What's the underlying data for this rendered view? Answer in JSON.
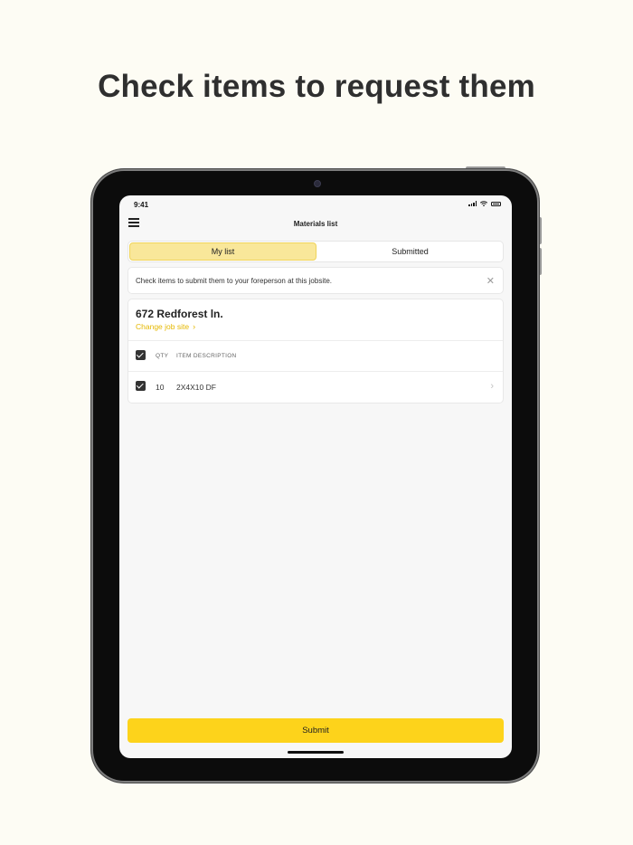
{
  "headline": "Check items to request them",
  "status_bar": {
    "time": "9:41"
  },
  "nav": {
    "title": "Materials list"
  },
  "tabs": [
    {
      "label": "My list",
      "active": true
    },
    {
      "label": "Submitted",
      "active": false
    }
  ],
  "notice": {
    "text": "Check items to submit them to your foreperson at this jobsite."
  },
  "jobsite": {
    "address": "672 Redforest ln.",
    "change_label": "Change job site"
  },
  "table": {
    "headers": {
      "qty": "QTY",
      "description": "ITEM DESCRIPTION"
    },
    "rows": [
      {
        "qty": "10",
        "description": "2X4X10 DF",
        "checked": true
      }
    ]
  },
  "submit_label": "Submit",
  "colors": {
    "accent": "#fdd31b",
    "tab_active": "#f9e79a",
    "link": "#e5b800",
    "background": "#fdfcf4"
  }
}
